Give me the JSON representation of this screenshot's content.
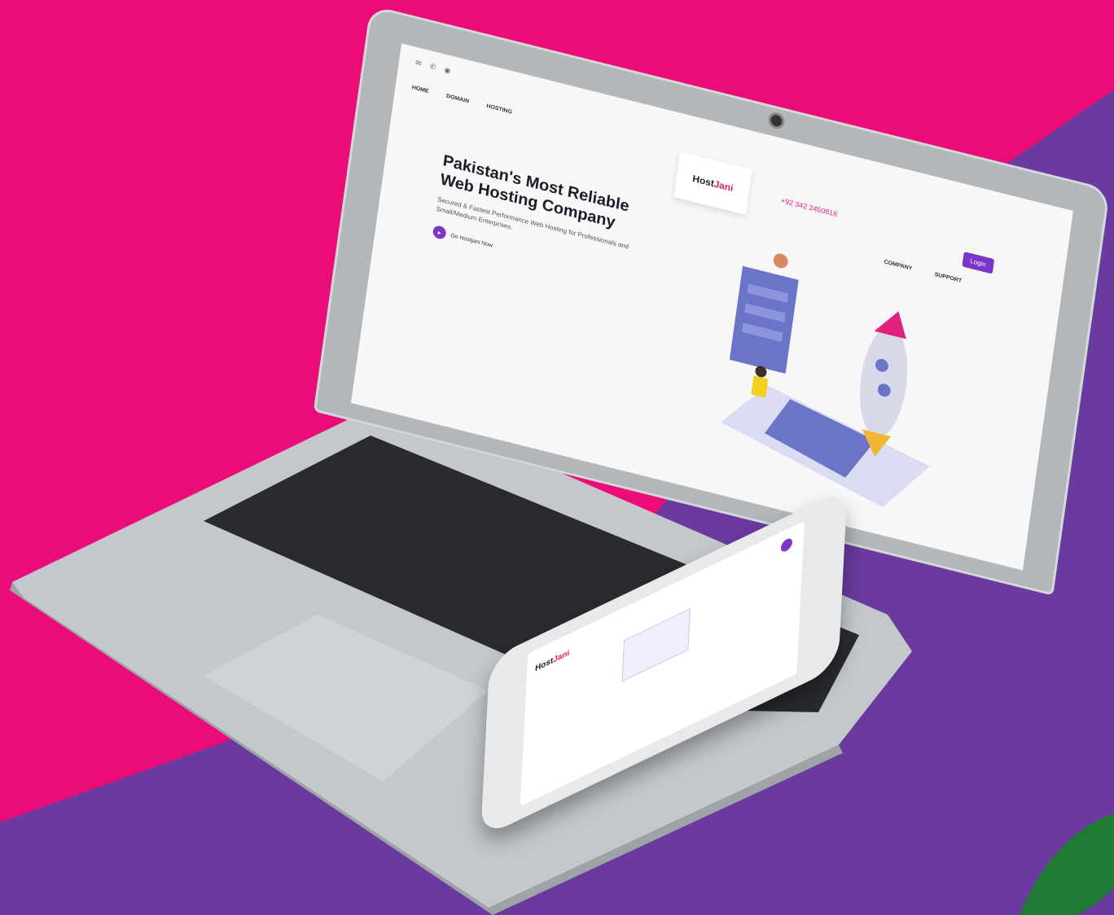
{
  "colors": {
    "background_pink": "#ec0c78",
    "background_purple": "#6a3a9f",
    "accent_purple": "#7b35c8",
    "brand_pink": "#e0207d"
  },
  "laptop_screen": {
    "topbar_icons": "✉ ✆ ◉",
    "nav": [
      "HOME",
      "DOMAIN",
      "HOSTING"
    ],
    "logo": {
      "main": "Host",
      "accent": "Jani"
    },
    "phone": "+92 342 2450818",
    "login_label": "Login",
    "nav_right": [
      "COMPANY",
      "SUPPORT"
    ],
    "hero_title": "Pakistan's Most Reliable Web Hosting Company",
    "hero_subtitle": "Secured & Fastest Performance Web Hosting for Professionals and Small/Medium Enterprises.",
    "cta_label": "Go Hostjani Now"
  },
  "phone_screen": {
    "logo": {
      "main": "Host",
      "accent": "Jani"
    }
  }
}
